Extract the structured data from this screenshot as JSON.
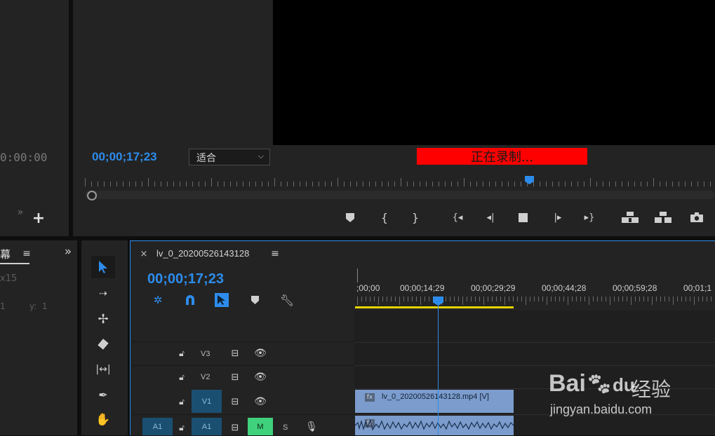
{
  "source_monitor": {
    "timecode": "0:00:00"
  },
  "program_monitor": {
    "timecode": "00;00;17;23",
    "fit_select": "适合",
    "recording_banner": "正在录制..."
  },
  "left_panel": {
    "title": "幕",
    "line1": "x15",
    "line2a": "1",
    "line2b": "y:  1"
  },
  "timeline": {
    "tab_title": "lv_0_20200526143128",
    "timecode": "00;00;17;23",
    "ruler_labels": [
      ";00;00",
      "00;00;14;29",
      "00;00;29;29",
      "00;00;44;28",
      "00;00;59;28",
      "00;01;1"
    ],
    "tracks": {
      "v3": "V3",
      "v2": "V2",
      "v1": "V1",
      "a1_src": "A1",
      "a1": "A1",
      "mute": "M",
      "solo": "S"
    },
    "video_clip_label": "lv_0_20200526143128.mp4 [V]",
    "fx_badge": "fx"
  },
  "watermark": {
    "brand": "Bai",
    "brand2": "du",
    "cn": "经验",
    "url": "jingyan.baidu.com"
  },
  "colors": {
    "accent": "#2d8ceb",
    "record": "#ff0000",
    "clip_video": "#7b9ccc",
    "work_area": "#e6d400",
    "mute_green": "#3fd17c"
  }
}
